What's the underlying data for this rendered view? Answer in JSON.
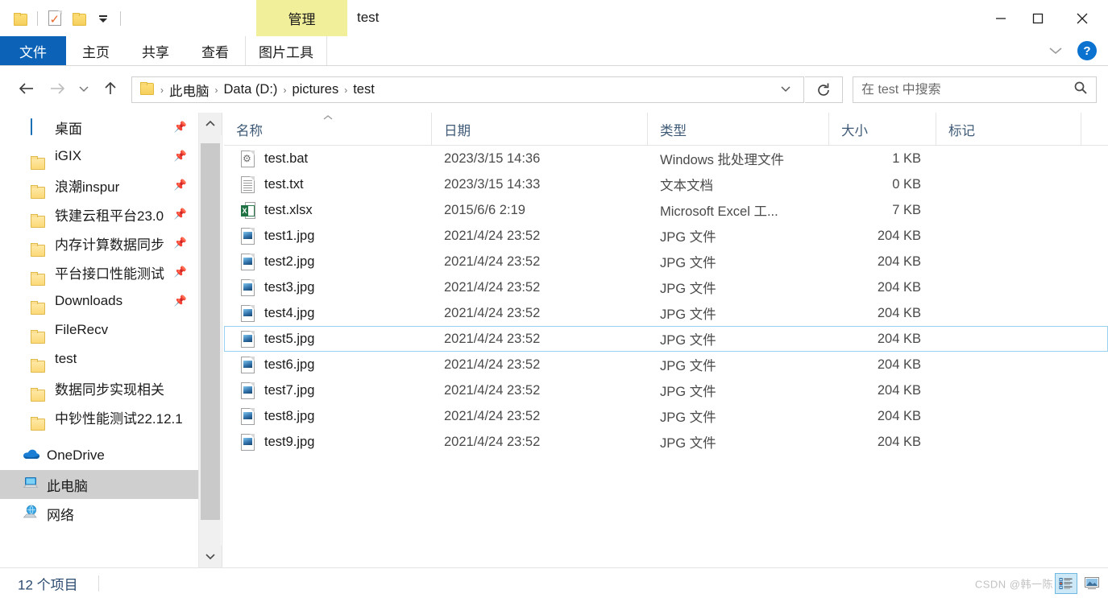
{
  "window": {
    "title": "test",
    "contextual_tab": "管理",
    "minimize_label": "最小化",
    "maximize_label": "最大化",
    "close_label": "关闭"
  },
  "quick_access": {
    "folder_icon": "folder-icon",
    "properties_icon": "properties-icon",
    "new_folder_icon": "new-folder-icon",
    "customize_icon": "customize-dropdown-icon"
  },
  "ribbon": {
    "tabs": [
      {
        "label": "文件",
        "active": true
      },
      {
        "label": "主页",
        "active": false
      },
      {
        "label": "共享",
        "active": false
      },
      {
        "label": "查看",
        "active": false
      },
      {
        "label": "图片工具",
        "active": false
      }
    ],
    "collapse_icon": "chevron-down-icon",
    "help_label": "?"
  },
  "address": {
    "back_icon": "back-arrow-icon",
    "forward_icon": "forward-arrow-icon",
    "recent_icon": "chevron-down-icon",
    "up_icon": "up-arrow-icon",
    "folder_icon": "folder-icon",
    "breadcrumbs": [
      "此电脑",
      "Data (D:)",
      "pictures",
      "test"
    ],
    "separator": "›",
    "dropdown_icon": "chevron-down-icon",
    "refresh_icon": "refresh-icon"
  },
  "search": {
    "placeholder": "在 test 中搜索",
    "value": "",
    "icon": "search-icon"
  },
  "sidebar": {
    "scroll_up_icon": "chevron-up-icon",
    "scroll_down_icon": "chevron-down-icon",
    "items": [
      {
        "label": "桌面",
        "icon": "desktop-icon",
        "pinned": true,
        "selected": false
      },
      {
        "label": "iGIX",
        "icon": "folder-icon",
        "pinned": true,
        "selected": false
      },
      {
        "label": "浪潮inspur",
        "icon": "folder-icon",
        "pinned": true,
        "selected": false
      },
      {
        "label": "铁建云租平台23.0",
        "icon": "folder-icon",
        "pinned": true,
        "selected": false
      },
      {
        "label": "内存计算数据同步",
        "icon": "folder-icon",
        "pinned": true,
        "selected": false
      },
      {
        "label": "平台接口性能测试",
        "icon": "folder-icon",
        "pinned": true,
        "selected": false
      },
      {
        "label": "Downloads",
        "icon": "folder-icon",
        "pinned": true,
        "selected": false
      },
      {
        "label": "FileRecv",
        "icon": "folder-icon",
        "pinned": false,
        "selected": false
      },
      {
        "label": "test",
        "icon": "folder-icon",
        "pinned": false,
        "selected": false
      },
      {
        "label": "数据同步实现相关",
        "icon": "folder-icon",
        "pinned": false,
        "selected": false
      },
      {
        "label": "中钞性能测试22.12.1",
        "icon": "folder-icon",
        "pinned": false,
        "selected": false
      }
    ],
    "roots": [
      {
        "label": "OneDrive",
        "icon": "onedrive-icon",
        "selected": false
      },
      {
        "label": "此电脑",
        "icon": "this-pc-icon",
        "selected": true
      },
      {
        "label": "网络",
        "icon": "network-icon",
        "selected": false
      }
    ]
  },
  "filelist": {
    "columns": [
      {
        "label": "名称",
        "sorted": true,
        "sort_arrow": "︿"
      },
      {
        "label": "日期",
        "sorted": false,
        "sort_arrow": ""
      },
      {
        "label": "类型",
        "sorted": false,
        "sort_arrow": ""
      },
      {
        "label": "大小",
        "sorted": false,
        "sort_arrow": ""
      },
      {
        "label": "标记",
        "sorted": false,
        "sort_arrow": ""
      }
    ],
    "rows": [
      {
        "name": "test.bat",
        "date": "2023/3/15 14:36",
        "type": "Windows 批处理文件",
        "size": "1 KB",
        "tags": "",
        "icon": "bat-file-icon",
        "selected": false
      },
      {
        "name": "test.txt",
        "date": "2023/3/15 14:33",
        "type": "文本文档",
        "size": "0 KB",
        "tags": "",
        "icon": "txt-file-icon",
        "selected": false
      },
      {
        "name": "test.xlsx",
        "date": "2015/6/6 2:19",
        "type": "Microsoft Excel 工...",
        "size": "7 KB",
        "tags": "",
        "icon": "xlsx-file-icon",
        "selected": false
      },
      {
        "name": "test1.jpg",
        "date": "2021/4/24 23:52",
        "type": "JPG 文件",
        "size": "204 KB",
        "tags": "",
        "icon": "jpg-file-icon",
        "selected": false
      },
      {
        "name": "test2.jpg",
        "date": "2021/4/24 23:52",
        "type": "JPG 文件",
        "size": "204 KB",
        "tags": "",
        "icon": "jpg-file-icon",
        "selected": false
      },
      {
        "name": "test3.jpg",
        "date": "2021/4/24 23:52",
        "type": "JPG 文件",
        "size": "204 KB",
        "tags": "",
        "icon": "jpg-file-icon",
        "selected": false
      },
      {
        "name": "test4.jpg",
        "date": "2021/4/24 23:52",
        "type": "JPG 文件",
        "size": "204 KB",
        "tags": "",
        "icon": "jpg-file-icon",
        "selected": false
      },
      {
        "name": "test5.jpg",
        "date": "2021/4/24 23:52",
        "type": "JPG 文件",
        "size": "204 KB",
        "tags": "",
        "icon": "jpg-file-icon",
        "selected": true
      },
      {
        "name": "test6.jpg",
        "date": "2021/4/24 23:52",
        "type": "JPG 文件",
        "size": "204 KB",
        "tags": "",
        "icon": "jpg-file-icon",
        "selected": false
      },
      {
        "name": "test7.jpg",
        "date": "2021/4/24 23:52",
        "type": "JPG 文件",
        "size": "204 KB",
        "tags": "",
        "icon": "jpg-file-icon",
        "selected": false
      },
      {
        "name": "test8.jpg",
        "date": "2021/4/24 23:52",
        "type": "JPG 文件",
        "size": "204 KB",
        "tags": "",
        "icon": "jpg-file-icon",
        "selected": false
      },
      {
        "name": "test9.jpg",
        "date": "2021/4/24 23:52",
        "type": "JPG 文件",
        "size": "204 KB",
        "tags": "",
        "icon": "jpg-file-icon",
        "selected": false
      }
    ]
  },
  "status": {
    "item_count": "12 个项目",
    "watermark": "CSDN @韩一陈",
    "view_details_icon": "details-view-icon",
    "view_large_icons_icon": "large-icons-view-icon",
    "active_view": "details"
  },
  "colors": {
    "file_tab_blue": "#0b62b7",
    "contextual_yellow": "#f2ef9b",
    "selection_border": "#99d1f2",
    "nav_selected": "#cfcfcf",
    "header_text": "#3e5a76"
  }
}
